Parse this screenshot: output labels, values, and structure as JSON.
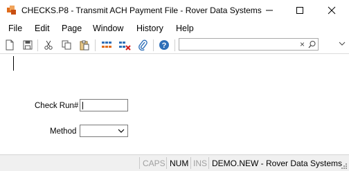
{
  "window": {
    "title": "CHECKS.P8 - Transmit ACH Payment File - Rover Data Systems"
  },
  "menu": {
    "items": [
      "File",
      "Edit",
      "Page",
      "Window",
      "History",
      "Help"
    ]
  },
  "toolbar": {
    "buttons": [
      "new-page-icon",
      "save-icon",
      "cut-icon",
      "copy-icon",
      "paste-icon",
      "grid-icon",
      "delete-grid-icon",
      "attach-icon",
      "help-icon"
    ],
    "search": {
      "value": "",
      "clear_glyph": "×"
    }
  },
  "form": {
    "check_run": {
      "label": "Check Run#",
      "value": ""
    },
    "method": {
      "label": "Method",
      "value": ""
    }
  },
  "status": {
    "caps": "CAPS",
    "num": "NUM",
    "ins": "INS",
    "account": "DEMO.NEW - Rover Data Systems"
  },
  "colors": {
    "accent_blue": "#2f6fb8",
    "icon_orange": "#e06c1c",
    "disabled_text": "#a0a0a0"
  }
}
